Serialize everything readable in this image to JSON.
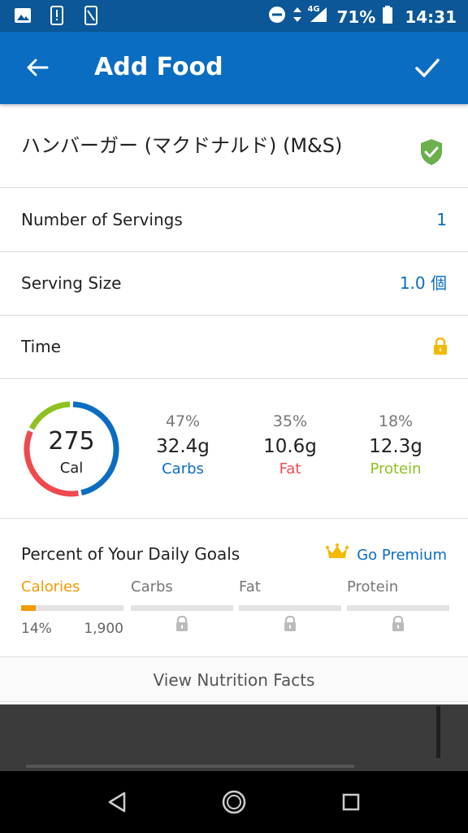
{
  "status_bar": {
    "battery": "71%",
    "time": "14:31",
    "network": "4G",
    "icons": [
      "image-icon",
      "alert-icon",
      "phone-icon",
      "dnd-icon",
      "signal-icon",
      "battery-icon"
    ]
  },
  "app_bar": {
    "title": "Add Food",
    "back_icon": "arrow-left-icon",
    "confirm_icon": "check-icon"
  },
  "food": {
    "name": "ハンバーガー (マクドナルド) (M&S)",
    "verified_icon": "shield-check-icon",
    "verified_color": "#6ab04c"
  },
  "fields": [
    {
      "label": "Number of Servings",
      "value": "1"
    },
    {
      "label": "Serving Size",
      "value": "1.0 個"
    },
    {
      "label": "Time",
      "value": ""
    }
  ],
  "summary": {
    "calories": "275",
    "calories_unit": "Cal",
    "macros": [
      {
        "pct": "47%",
        "amount": "32.4g",
        "name": "Carbs",
        "color": "#0a6dc2",
        "share": 0.47
      },
      {
        "pct": "35%",
        "amount": "10.6g",
        "name": "Fat",
        "color": "#f0484c",
        "share": 0.35
      },
      {
        "pct": "18%",
        "amount": "12.3g",
        "name": "Protein",
        "color": "#8dc21f",
        "share": 0.18
      }
    ]
  },
  "goals": {
    "heading": "Percent of Your Daily Goals",
    "premium_label": "Go Premium",
    "premium_icon": "crown-icon",
    "premium_color": "#f5b800",
    "columns": [
      {
        "name": "Calories",
        "pct": "14%",
        "goal": "1,900",
        "progress": 0.14,
        "locked": false
      },
      {
        "name": "Carbs",
        "locked": true
      },
      {
        "name": "Fat",
        "locked": true
      },
      {
        "name": "Protein",
        "locked": true
      }
    ]
  },
  "nutrition_button": "View Nutrition Facts",
  "colors": {
    "status_bar": "#0b5797",
    "app_bar": "#0a6dc2",
    "accent": "#0a6dc2",
    "calories_accent": "#f29b00",
    "lock": "#f5b800"
  }
}
